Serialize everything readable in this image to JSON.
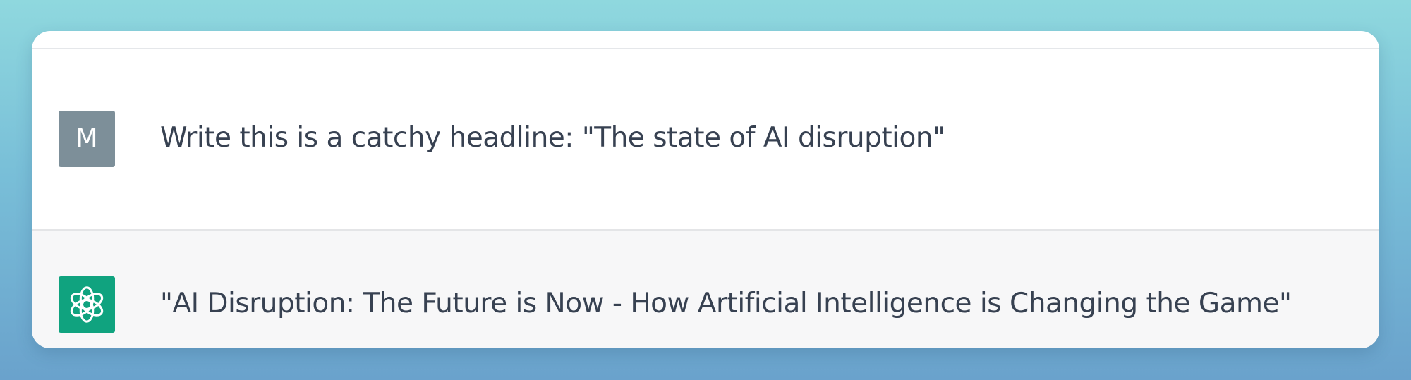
{
  "conversation": {
    "messages": [
      {
        "role": "user",
        "avatar_letter": "M",
        "avatar_color": "#7d8f99",
        "text": "Write this is a catchy headline: \"The state of AI disruption\""
      },
      {
        "role": "assistant",
        "avatar_icon": "openai-logo-icon",
        "avatar_color": "#10a37f",
        "text": "\"AI Disruption: The Future is Now - How Artificial Intelligence is Changing the Game\""
      }
    ]
  }
}
